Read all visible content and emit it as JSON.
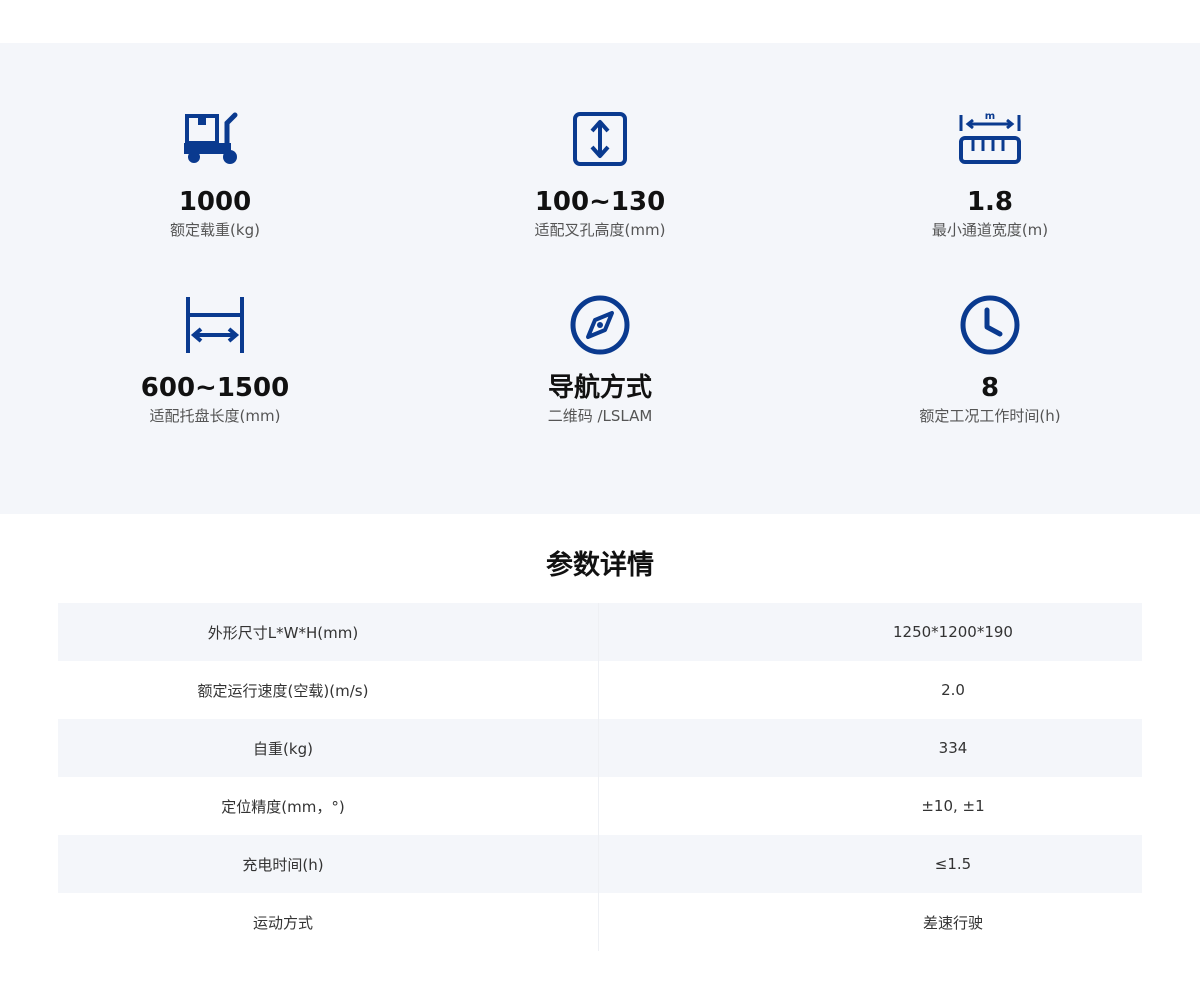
{
  "features": [
    {
      "icon": "pallet-truck-icon",
      "value": "1000",
      "label": "额定载重(kg)"
    },
    {
      "icon": "vertical-arrows-icon",
      "value": "100~130",
      "label": "适配叉孔高度(mm)"
    },
    {
      "icon": "ruler-icon",
      "icon_text": "m",
      "value": "1.8",
      "label": "最小通道宽度(m)"
    },
    {
      "icon": "width-bracket-icon",
      "value": "600~1500",
      "label": "适配托盘长度(mm)"
    },
    {
      "icon": "compass-icon",
      "value": "导航方式",
      "label": "二维码 /LSLAM"
    },
    {
      "icon": "clock-icon",
      "value": "8",
      "label": "额定工况工作时间(h)"
    }
  ],
  "specs": {
    "title": "参数详情",
    "rows": [
      {
        "name": "外形尺寸L*W*H(mm)",
        "value": "1250*1200*190"
      },
      {
        "name": "额定运行速度(空载)(m/s)",
        "value": "2.0"
      },
      {
        "name": "自重(kg)",
        "value": "334"
      },
      {
        "name": "定位精度(mm，°)",
        "value": "±10, ±1"
      },
      {
        "name": "充电时间(h)",
        "value": "≤1.5"
      },
      {
        "name": "运动方式",
        "value": "差速行驶"
      }
    ]
  },
  "colors": {
    "accent": "#0a3a8f",
    "panel_bg": "#f4f6fa"
  }
}
